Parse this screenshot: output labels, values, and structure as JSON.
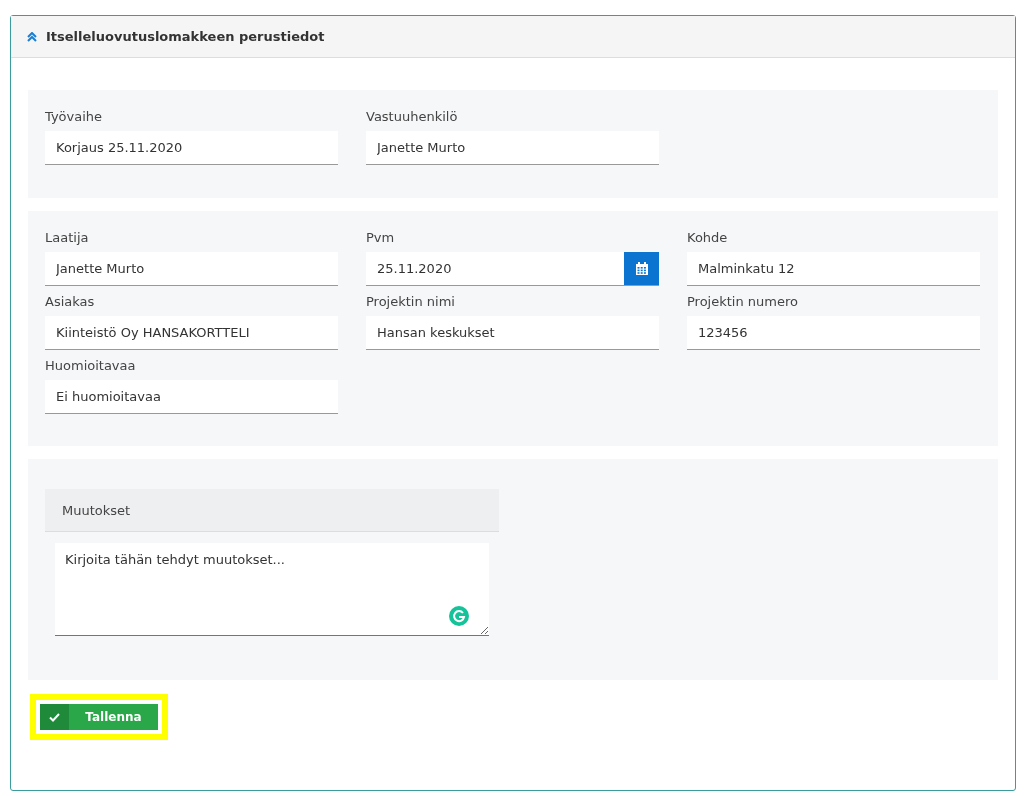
{
  "panel": {
    "title": "Itselleluovutuslomakkeen perustiedot",
    "expanded": true
  },
  "sections": [
    {
      "fields": [
        {
          "label": "Työvaihe",
          "value": "Korjaus 25.11.2020",
          "kind": "text"
        },
        {
          "label": "Vastuuhenkilö",
          "value": "Janette Murto",
          "kind": "text"
        }
      ]
    },
    {
      "fields": [
        {
          "label": "Laatija",
          "value": "Janette Murto",
          "kind": "text"
        },
        {
          "label": "Pvm",
          "value": "25.11.2020",
          "kind": "date"
        },
        {
          "label": "Kohde",
          "value": "Malminkatu 12",
          "kind": "text"
        },
        {
          "label": "Asiakas",
          "value": "Kiinteistö Oy HANSAKORTTELI",
          "kind": "text"
        },
        {
          "label": "Projektin nimi",
          "value": "Hansan keskukset",
          "kind": "text"
        },
        {
          "label": "Projektin numero",
          "value": "123456",
          "kind": "text"
        },
        {
          "label": "Huomioitavaa",
          "value": "Ei huomioitavaa",
          "kind": "text"
        }
      ]
    }
  ],
  "changes": {
    "title": "Muutokset",
    "value": "Kirjoita tähän tehdyt muutokset..."
  },
  "save_button": {
    "label": "Tallenna",
    "highlighted": true
  }
}
